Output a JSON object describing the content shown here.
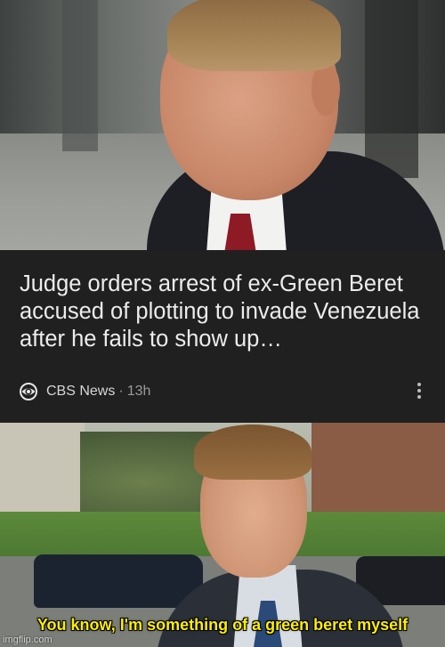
{
  "news_card": {
    "headline": "Judge orders arrest of ex-Green Beret accused of plotting to invade Venezuela after he fails to show up…",
    "source": "CBS News",
    "separator": "·",
    "time": "13h",
    "source_icon": "cbs-eye-icon",
    "menu_icon": "more-vert-icon"
  },
  "meme": {
    "caption": "You know, I'm something of a green beret myself",
    "watermark": "imgflip.com"
  },
  "colors": {
    "card_background": "#202020",
    "headline_text": "#ececec",
    "caption_text": "#ffee00"
  }
}
